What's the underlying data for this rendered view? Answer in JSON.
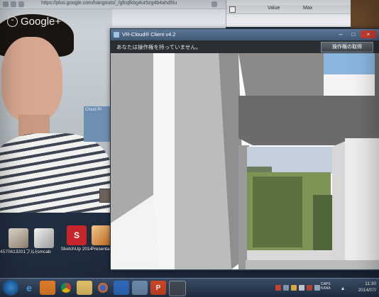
{
  "browser": {
    "address": "https://plus.google.com/hangouts/_/gfcqfkbg4ur5zg4b4ahd5lu",
    "brand": "Google+",
    "cloud_tile_label": "Cloud Pr"
  },
  "properties_panel": {
    "col_value": "Value",
    "col_max": "Max"
  },
  "desktop_icons": [
    {
      "label": "4570613201フルビャー",
      "icon": "photo-thumbnail-icon"
    },
    {
      "label": "smcab",
      "icon": "image-file-icon"
    },
    {
      "label": "SketchUp 2014",
      "icon": "sketchup-icon"
    },
    {
      "label": "Presentati",
      "icon": "presentation-icon"
    }
  ],
  "vr_window": {
    "title": "VR-Cloud® Client v4.2",
    "info_text": "あなたは操作権を持っていません。",
    "control_button": "操作権の取得",
    "minimize": "–",
    "maximize": "□",
    "close": "×"
  },
  "taskbar": {
    "apps": [
      "ie-icon",
      "media-player-icon",
      "chrome-icon",
      "file-explorer-icon",
      "firefox-icon",
      "outlook-icon",
      "cloud-app-icon",
      "powerpoint-icon",
      "window-app-icon"
    ],
    "lang_top": "CAPS",
    "lang_bottom": "KANA",
    "time": "11:30",
    "date": "2014/07/"
  },
  "colors": {
    "powerpoint": "#d24726",
    "sketchup": "#c6262b",
    "taskbar": "#2c3e56"
  }
}
